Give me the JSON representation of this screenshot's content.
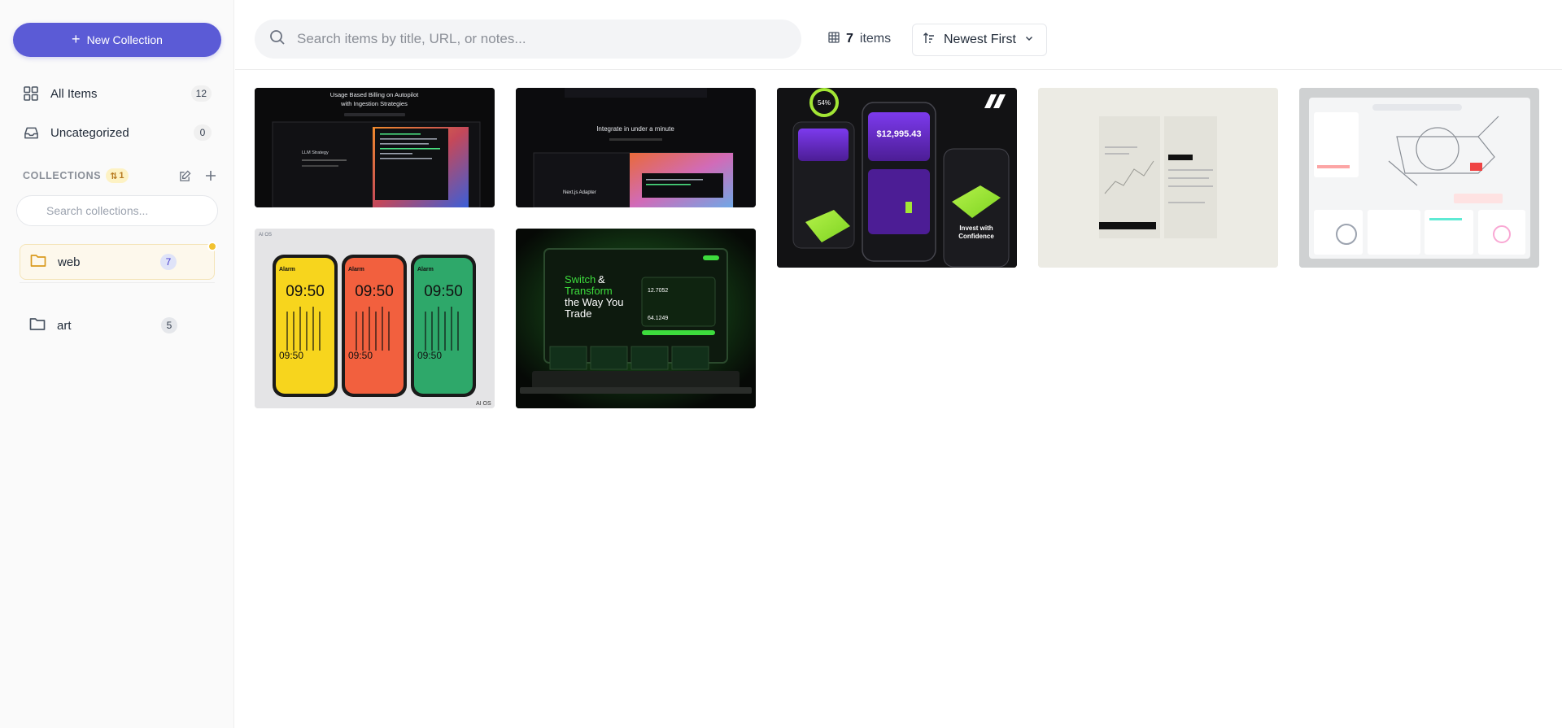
{
  "sidebar": {
    "new_collection_label": "New Collection",
    "nav": [
      {
        "label": "All Items",
        "count": "12",
        "icon": "grid-icon"
      },
      {
        "label": "Uncategorized",
        "count": "0",
        "icon": "inbox-icon"
      }
    ],
    "collections_title": "COLLECTIONS",
    "collections_badge": "1",
    "collection_search_placeholder": "Search collections...",
    "folders": [
      {
        "label": "web",
        "count": "7",
        "active": true
      },
      {
        "label": "art",
        "count": "5",
        "active": false
      }
    ]
  },
  "header": {
    "search_placeholder": "Search items by title, URL, or notes...",
    "item_count": "7",
    "item_count_label": "items",
    "sort_label": "Newest First"
  },
  "items": [
    {
      "title": "Usage Based Billing on Autopilot with Ingestion Strategies",
      "sub": "LLM Strategy"
    },
    {
      "title": "Integrate in under a minute",
      "sub": "Next.js Adapter"
    },
    {
      "title": "$12,995.43",
      "percent": "54%",
      "sub": "Invest with Confidence"
    },
    {
      "title": "",
      "sub": ""
    },
    {
      "title": "",
      "sub": ""
    },
    {
      "title": "Alarm",
      "time": "09:50",
      "brand": "AI OS"
    },
    {
      "title": "Switch & Transform the Way You Trade",
      "value1": "12.7052",
      "value2": "64.1249"
    }
  ],
  "colors": {
    "accent": "#5b5bd6",
    "badge": "#f2c230"
  }
}
